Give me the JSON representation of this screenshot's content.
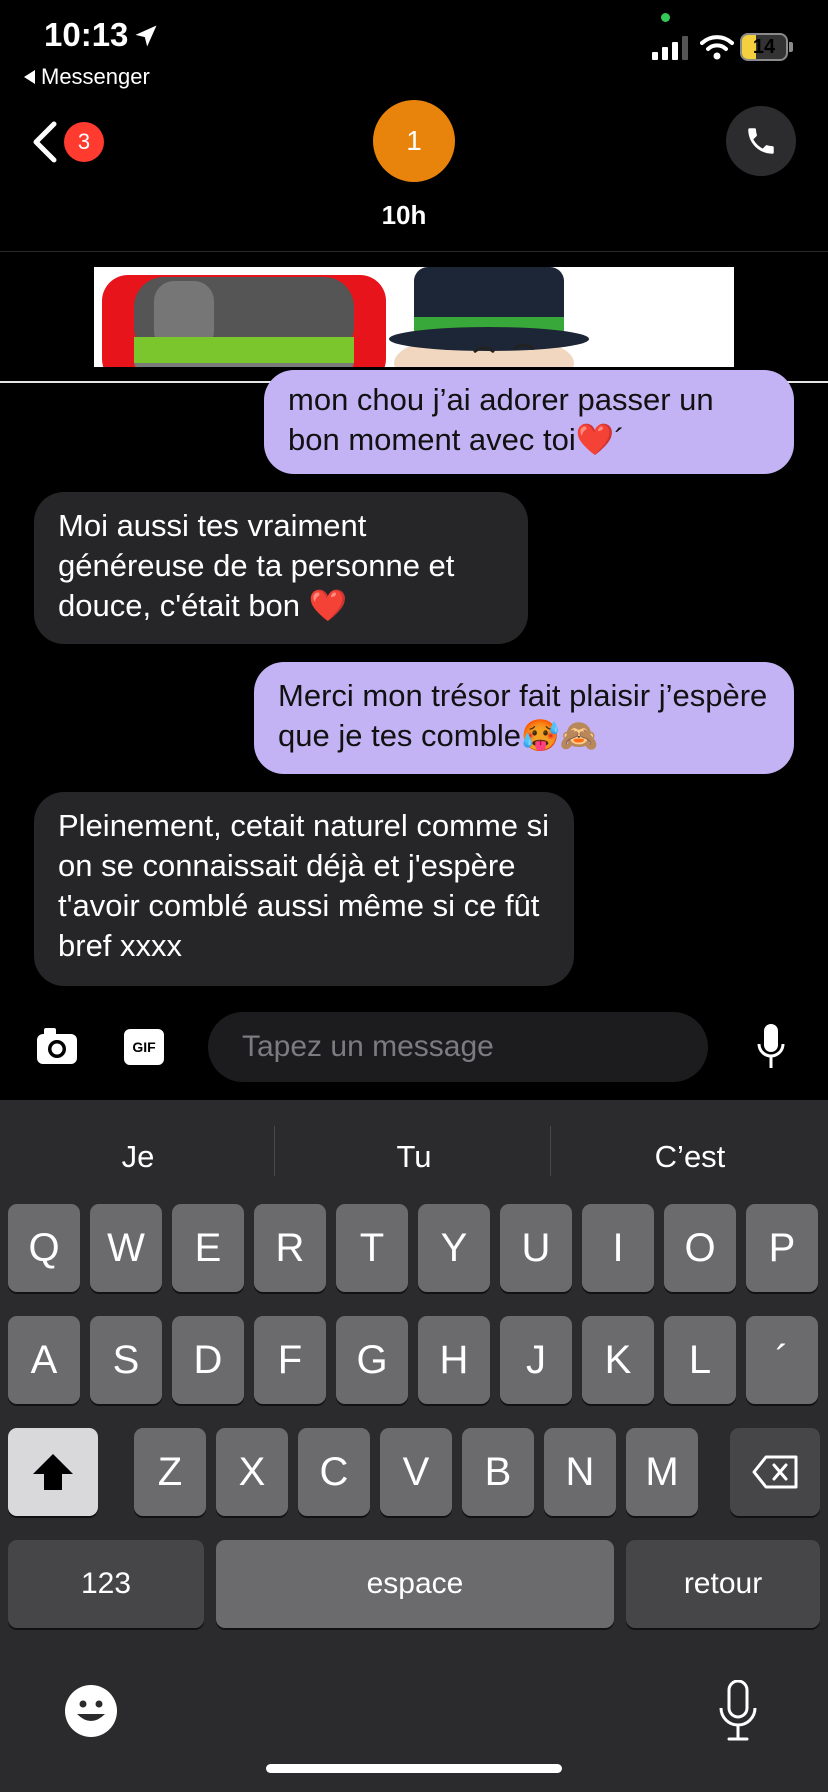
{
  "status_bar": {
    "time": "10:13",
    "back_app": "Messenger",
    "battery": "14",
    "battery_percent": 14
  },
  "header": {
    "badge_count": "3",
    "avatar_text": "1",
    "subtitle": "10h"
  },
  "messages": [
    {
      "dir": "out",
      "text": "mon chou j’ai adorer passer un bon moment avec toi❤️´"
    },
    {
      "dir": "in",
      "text": "Moi aussi tes vraiment généreuse de ta personne et douce, c'était bon ❤️"
    },
    {
      "dir": "out",
      "text": "Merci mon trésor fait plaisir j’espère que je tes comble🥵🙈"
    },
    {
      "dir": "in",
      "text": "Pleinement, cetait naturel comme si on se connaissait déjà et j'espère t'avoir comblé aussi même si ce fût bref xxxx"
    }
  ],
  "composer": {
    "gif_label": "GIF",
    "placeholder": "Tapez un message"
  },
  "keyboard": {
    "suggestions": [
      "Je",
      "Tu",
      "C’est"
    ],
    "row1": [
      "Q",
      "W",
      "E",
      "R",
      "T",
      "Y",
      "U",
      "I",
      "O",
      "P"
    ],
    "row2": [
      "A",
      "S",
      "D",
      "F",
      "G",
      "H",
      "J",
      "K",
      "L",
      "´"
    ],
    "row3": [
      "Z",
      "X",
      "C",
      "V",
      "B",
      "N",
      "M"
    ],
    "numbers_label": "123",
    "space_label": "espace",
    "return_label": "retour"
  },
  "colors": {
    "outgoing_bubble": "#c3b3f5",
    "incoming_bubble": "#262628",
    "avatar": "#e8830c",
    "badge": "#ff3b30"
  }
}
